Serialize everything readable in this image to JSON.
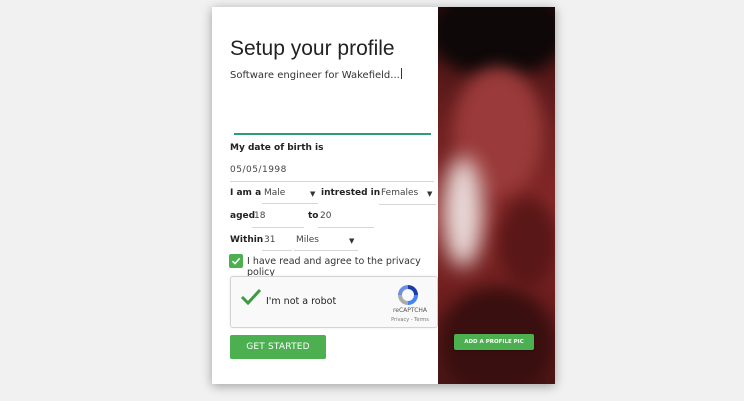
{
  "form": {
    "title": "Setup your profile",
    "bio_value": "Software engineer for Wakefield...",
    "dob_label": "My date of birth is",
    "dob_value": "05/05/1998",
    "iam_label": "I am a",
    "gender_value": "Male",
    "interested_label": "intrested in",
    "interest_value": "Females",
    "aged_label": "aged",
    "age_from": "18",
    "to_label": "to",
    "age_to": "20",
    "within_label": "Within",
    "distance_value": "31",
    "unit_value": "Miles",
    "agree_text": "I have read and agree to the privacy policy",
    "agree_checked": true,
    "submit_label": "GET STARTED"
  },
  "captcha": {
    "label": "I'm not a robot",
    "brand": "reCAPTCHA",
    "links": "Privacy - Terms"
  },
  "photo": {
    "button_label": "ADD A PROFILE PIC"
  },
  "colors": {
    "accent": "#4caf50",
    "bio_underline": "#2e9e7a",
    "background": "#f1f1f1"
  }
}
